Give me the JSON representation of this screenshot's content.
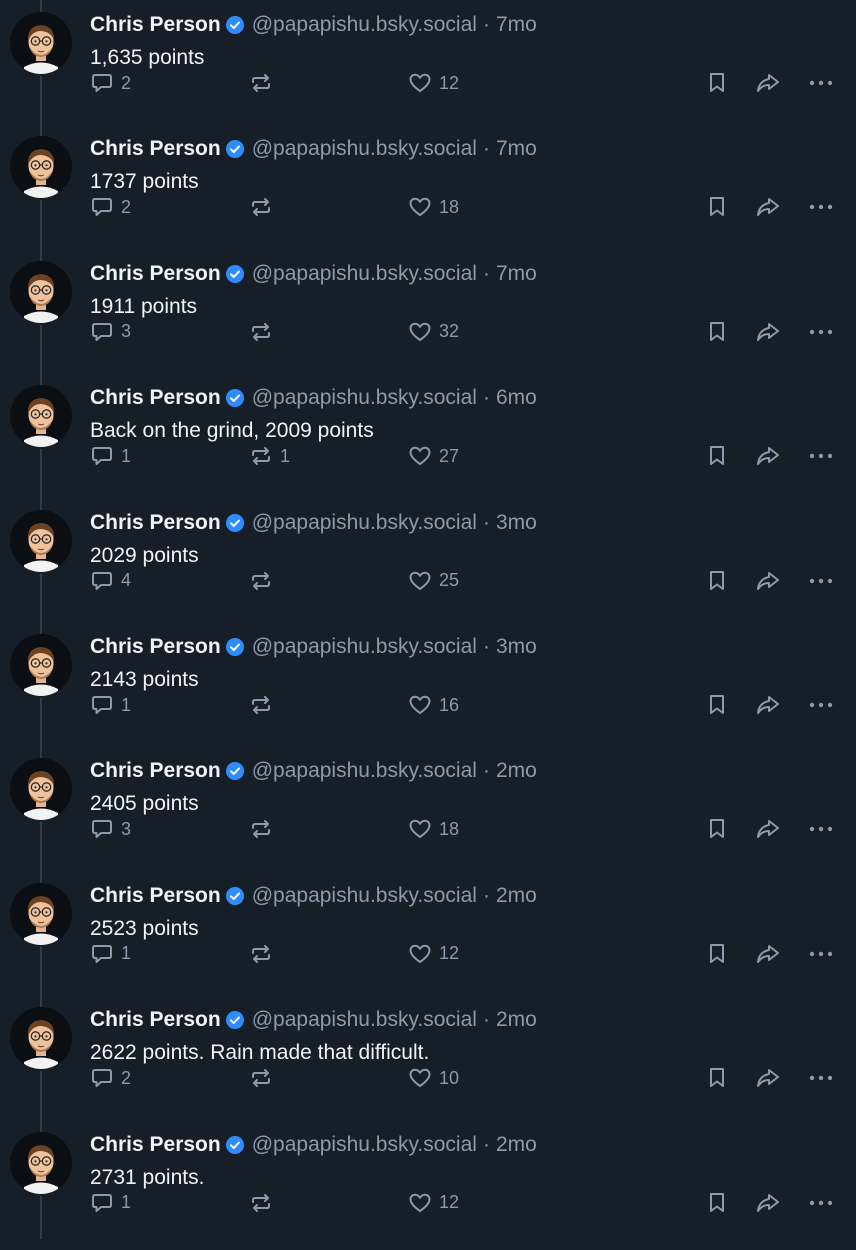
{
  "colors": {
    "background": "#161e27",
    "text": "#f1f3f5",
    "muted": "#8d9aab",
    "verified": "#2f8cff",
    "thread_line": "#2e3b49"
  },
  "icons": {
    "reply": "speech-bubble-icon",
    "repost": "repost-arrows-icon",
    "like": "heart-icon",
    "bookmark": "bookmark-icon",
    "share": "share-arrow-icon",
    "more": "more-dots-icon",
    "verified": "verified-check-icon"
  },
  "posts": [
    {
      "author": "Chris Person",
      "handle": "@papapishu.bsky.social",
      "sep": "·",
      "time": "7mo",
      "text": "1,635 points",
      "replies": "2",
      "reposts": "",
      "likes": "12"
    },
    {
      "author": "Chris Person",
      "handle": "@papapishu.bsky.social",
      "sep": "·",
      "time": "7mo",
      "text": "1737 points",
      "replies": "2",
      "reposts": "",
      "likes": "18"
    },
    {
      "author": "Chris Person",
      "handle": "@papapishu.bsky.social",
      "sep": "·",
      "time": "7mo",
      "text": "1911 points",
      "replies": "3",
      "reposts": "",
      "likes": "32"
    },
    {
      "author": "Chris Person",
      "handle": "@papapishu.bsky.social",
      "sep": "·",
      "time": "6mo",
      "text": "Back on the grind, 2009 points",
      "replies": "1",
      "reposts": "1",
      "likes": "27"
    },
    {
      "author": "Chris Person",
      "handle": "@papapishu.bsky.social",
      "sep": "·",
      "time": "3mo",
      "text": "2029 points",
      "replies": "4",
      "reposts": "",
      "likes": "25"
    },
    {
      "author": "Chris Person",
      "handle": "@papapishu.bsky.social",
      "sep": "·",
      "time": "3mo",
      "text": "2143 points",
      "replies": "1",
      "reposts": "",
      "likes": "16"
    },
    {
      "author": "Chris Person",
      "handle": "@papapishu.bsky.social",
      "sep": "·",
      "time": "2mo",
      "text": "2405 points",
      "replies": "3",
      "reposts": "",
      "likes": "18"
    },
    {
      "author": "Chris Person",
      "handle": "@papapishu.bsky.social",
      "sep": "·",
      "time": "2mo",
      "text": "2523 points",
      "replies": "1",
      "reposts": "",
      "likes": "12"
    },
    {
      "author": "Chris Person",
      "handle": "@papapishu.bsky.social",
      "sep": "·",
      "time": "2mo",
      "text": "2622 points. Rain made that difficult.",
      "replies": "2",
      "reposts": "",
      "likes": "10"
    },
    {
      "author": "Chris Person",
      "handle": "@papapishu.bsky.social",
      "sep": "·",
      "time": "2mo",
      "text": "2731 points.",
      "replies": "1",
      "reposts": "",
      "likes": "12"
    }
  ]
}
